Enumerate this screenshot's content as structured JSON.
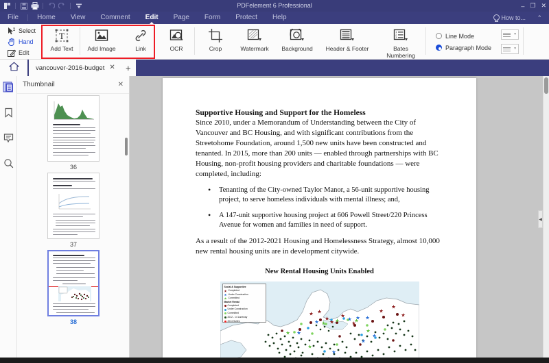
{
  "window": {
    "title": "PDFelement 6 Professional",
    "minimize": "–",
    "maximize": "❐",
    "close": "✕"
  },
  "quick_access": [
    {
      "name": "app-menu-icon",
      "glyph": "◰"
    },
    {
      "name": "save-icon",
      "glyph": "ὋE"
    },
    {
      "name": "print-icon",
      "glyph": "⎙"
    },
    {
      "name": "undo-icon",
      "glyph": "↶"
    },
    {
      "name": "redo-icon",
      "glyph": "↷"
    },
    {
      "name": "customize-icon",
      "glyph": "▼"
    }
  ],
  "menu": {
    "items": [
      {
        "label": "File",
        "active": false
      },
      {
        "label": "Home",
        "active": false
      },
      {
        "label": "View",
        "active": false
      },
      {
        "label": "Comment",
        "active": false
      },
      {
        "label": "Edit",
        "active": true
      },
      {
        "label": "Page",
        "active": false
      },
      {
        "label": "Form",
        "active": false
      },
      {
        "label": "Protect",
        "active": false
      },
      {
        "label": "Help",
        "active": false
      }
    ],
    "how_to": "How to...",
    "collapse": "⌃"
  },
  "ribbon": {
    "small_tools": [
      {
        "label": "Select",
        "icon": "cursor-arrow-icon"
      },
      {
        "label": "Hand",
        "icon": "hand-icon"
      },
      {
        "label": "Edit",
        "icon": "pencil-edit-icon"
      }
    ],
    "highlighted_group": [
      {
        "label": "Add Text",
        "icon": "add-text-icon"
      },
      {
        "label": "Add Image",
        "icon": "add-image-icon"
      },
      {
        "label": "Link",
        "icon": "link-icon"
      },
      {
        "label": "OCR",
        "icon": "ocr-icon"
      }
    ],
    "page_tools": [
      {
        "label": "Crop",
        "icon": "crop-icon",
        "dropdown": false
      },
      {
        "label": "Watermark",
        "icon": "watermark-icon",
        "dropdown": true
      },
      {
        "label": "Background",
        "icon": "background-icon",
        "dropdown": true
      },
      {
        "label": "Header & Footer",
        "icon": "header-footer-icon",
        "dropdown": true
      },
      {
        "label": "Bates Numbering",
        "icon": "bates-numbering-icon",
        "dropdown": true
      }
    ],
    "modes": [
      {
        "label": "Line Mode",
        "selected": false
      },
      {
        "label": "Paragraph Mode",
        "selected": true
      }
    ],
    "accent_red": "#ee1c25",
    "accent_blue": "#1b4dd8"
  },
  "tabs": {
    "home_icon": "home-icon",
    "document": {
      "label": "vancouver-2016-budget",
      "close": "✕"
    },
    "add": "+"
  },
  "rail": [
    {
      "name": "thumbnail-panel-icon",
      "active": true
    },
    {
      "name": "bookmark-panel-icon",
      "active": false
    },
    {
      "name": "comment-panel-icon",
      "active": false
    },
    {
      "name": "search-panel-icon",
      "active": false
    }
  ],
  "thumbnail_panel": {
    "title": "Thumbnail",
    "close": "✕",
    "pages": [
      {
        "number": "36",
        "selected": false,
        "kind": "area-chart"
      },
      {
        "number": "37",
        "selected": false,
        "kind": "line-chart"
      },
      {
        "number": "38",
        "selected": true,
        "kind": "map"
      }
    ]
  },
  "document": {
    "heading": "Supportive Housing and Support for the Homeless",
    "paragraph1": "Since 2010, under a Memorandum of Understanding between the City of Vancouver and BC Housing, and with significant contributions from the Streetohome Foundation, around 1,500 new units have been constructed and tenanted. In 2015, more than 200 units — enabled through partnerships with BC Housing, non-profit housing providers and charitable foundations — were completed, including:",
    "bullets": [
      "Tenanting of the City-owned Taylor Manor, a 56-unit supportive housing project, to serve homeless individuals with mental illness; and,",
      "A 147-unit supportive housing project at 606 Powell Street/220 Princess Avenue for women and families in need of support."
    ],
    "paragraph2": "As a result of the 2012-2021 Housing and Homelessness Strategy, almost 10,000 new rental housing units are in development citywide.",
    "figure_title": "New Rental Housing Units Enabled",
    "map_legend": {
      "groups": [
        {
          "header": "Social & Supportive",
          "entries": [
            {
              "label": "Completed",
              "color": "#8b1a1a",
              "shape": "star"
            },
            {
              "label": "Under Construction",
              "color": "#2a6fd6",
              "shape": "star"
            },
            {
              "label": "Committed",
              "color": "#5fbf3f",
              "shape": "star"
            }
          ]
        },
        {
          "header": "Market Rental",
          "entries": [
            {
              "label": "Completed",
              "color": "#8b1a1a",
              "shape": "dot"
            },
            {
              "label": "Under Construction",
              "color": "#2a9fe0",
              "shape": "dot"
            },
            {
              "label": "Committed",
              "color": "#7fd45f",
              "shape": "dot"
            }
          ]
        },
        {
          "header": "",
          "entries": [
            {
              "label": "2012 - 14 Laneway",
              "color": "#1d4f1d",
              "shape": "dot"
            },
            {
              "label": "2014 Suites",
              "color": "#ee2222",
              "shape": "dot"
            }
          ]
        }
      ]
    }
  },
  "scrollbars": {
    "document_collapse": "◀"
  }
}
